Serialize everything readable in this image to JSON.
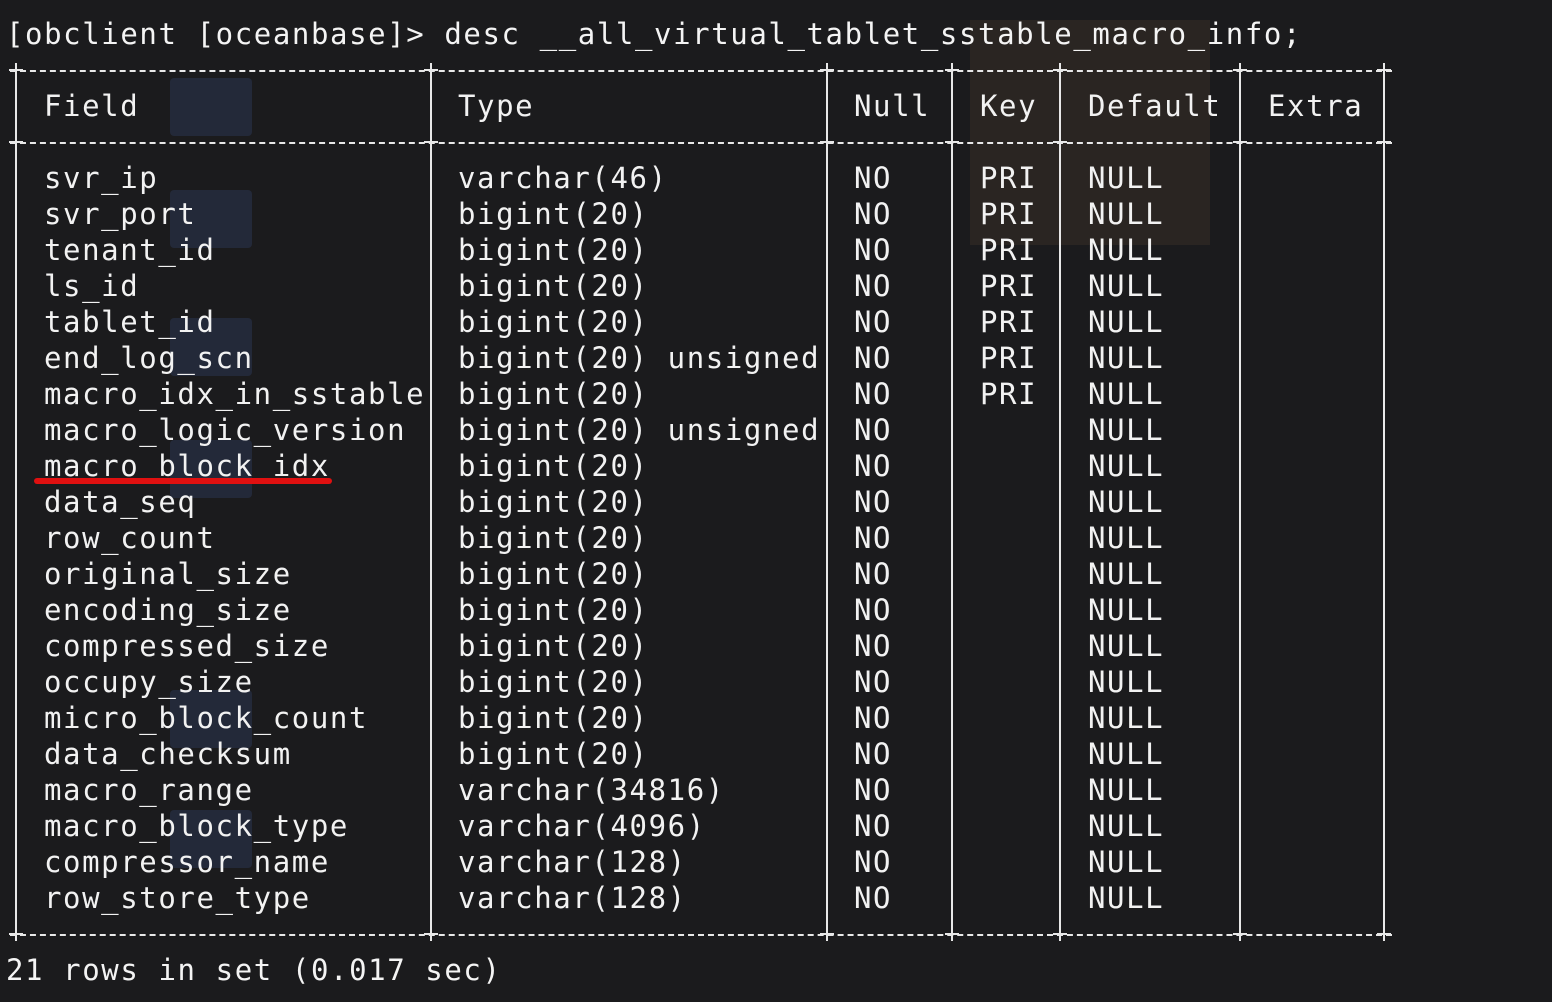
{
  "terminal": {
    "prompt_command": "[obclient [oceanbase]> desc __all_virtual_tablet_sstable_macro_info;",
    "footer": "21 rows in set (0.017 sec)",
    "highlight_color": "#e01010"
  },
  "table": {
    "headers": [
      "Field",
      "Type",
      "Null",
      "Key",
      "Default",
      "Extra"
    ],
    "rows": [
      [
        "svr_ip",
        "varchar(46)",
        "NO",
        "PRI",
        "NULL",
        ""
      ],
      [
        "svr_port",
        "bigint(20)",
        "NO",
        "PRI",
        "NULL",
        ""
      ],
      [
        "tenant_id",
        "bigint(20)",
        "NO",
        "PRI",
        "NULL",
        ""
      ],
      [
        "ls_id",
        "bigint(20)",
        "NO",
        "PRI",
        "NULL",
        ""
      ],
      [
        "tablet_id",
        "bigint(20)",
        "NO",
        "PRI",
        "NULL",
        ""
      ],
      [
        "end_log_scn",
        "bigint(20) unsigned",
        "NO",
        "PRI",
        "NULL",
        ""
      ],
      [
        "macro_idx_in_sstable",
        "bigint(20)",
        "NO",
        "PRI",
        "NULL",
        ""
      ],
      [
        "macro_logic_version",
        "bigint(20) unsigned",
        "NO",
        "",
        "NULL",
        ""
      ],
      [
        "macro_block_idx",
        "bigint(20)",
        "NO",
        "",
        "NULL",
        ""
      ],
      [
        "data_seq",
        "bigint(20)",
        "NO",
        "",
        "NULL",
        ""
      ],
      [
        "row_count",
        "bigint(20)",
        "NO",
        "",
        "NULL",
        ""
      ],
      [
        "original_size",
        "bigint(20)",
        "NO",
        "",
        "NULL",
        ""
      ],
      [
        "encoding_size",
        "bigint(20)",
        "NO",
        "",
        "NULL",
        ""
      ],
      [
        "compressed_size",
        "bigint(20)",
        "NO",
        "",
        "NULL",
        ""
      ],
      [
        "occupy_size",
        "bigint(20)",
        "NO",
        "",
        "NULL",
        ""
      ],
      [
        "micro_block_count",
        "bigint(20)",
        "NO",
        "",
        "NULL",
        ""
      ],
      [
        "data_checksum",
        "bigint(20)",
        "NO",
        "",
        "NULL",
        ""
      ],
      [
        "macro_range",
        "varchar(34816)",
        "NO",
        "",
        "NULL",
        ""
      ],
      [
        "macro_block_type",
        "varchar(4096)",
        "NO",
        "",
        "NULL",
        ""
      ],
      [
        "compressor_name",
        "varchar(128)",
        "NO",
        "",
        "NULL",
        ""
      ],
      [
        "row_store_type",
        "varchar(128)",
        "NO",
        "",
        "NULL",
        ""
      ]
    ]
  }
}
